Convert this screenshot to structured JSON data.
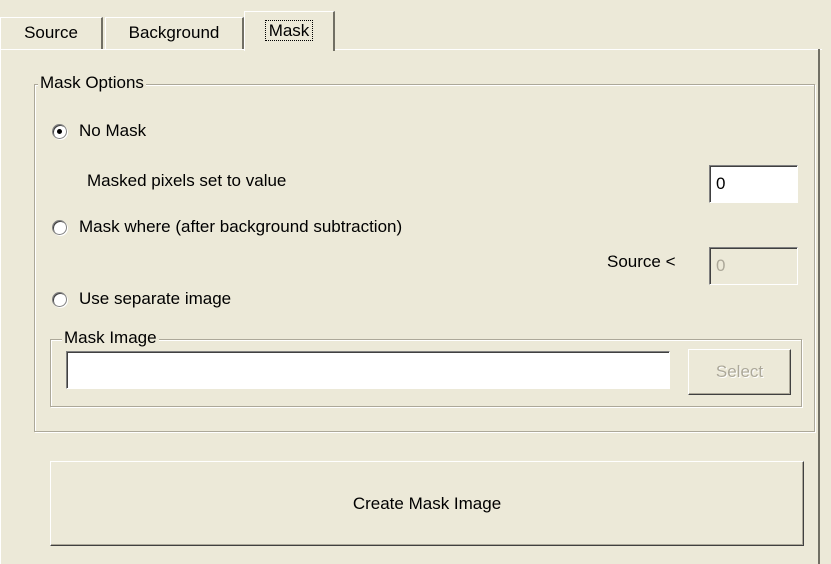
{
  "tabs": [
    {
      "label": "Source",
      "active": false
    },
    {
      "label": "Background",
      "active": false
    },
    {
      "label": "Mask",
      "active": true
    }
  ],
  "mask_options": {
    "title": "Mask Options",
    "no_mask": {
      "label": "No Mask",
      "checked": true
    },
    "masked_value": {
      "label": "Masked pixels set to value",
      "value": "0"
    },
    "mask_where": {
      "label": "Mask where (after background subtraction)",
      "checked": false
    },
    "source_threshold": {
      "label": "Source <",
      "value": "0",
      "enabled": false
    },
    "separate_image": {
      "label": "Use separate image",
      "checked": false
    }
  },
  "mask_image": {
    "title": "Mask Image",
    "path": "",
    "select_label": "Select",
    "select_enabled": false
  },
  "create_mask_label": "Create Mask Image"
}
